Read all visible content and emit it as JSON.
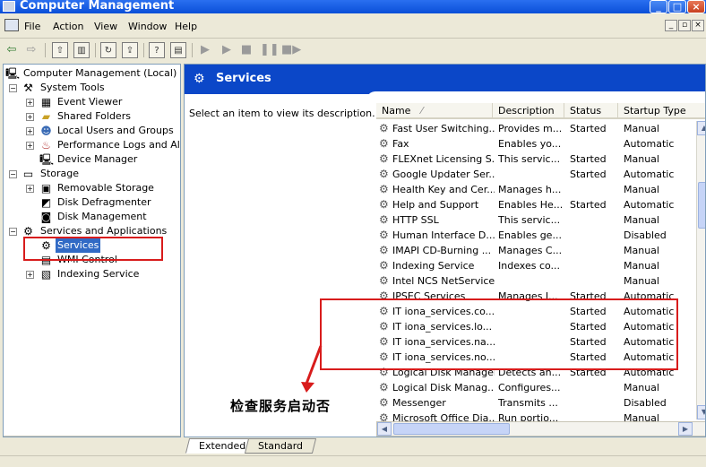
{
  "window": {
    "title": "Computer Management"
  },
  "menu": [
    "File",
    "Action",
    "View",
    "Window",
    "Help"
  ],
  "tree": [
    {
      "label": "Computer Management (Local)",
      "level": 0,
      "expander": "",
      "icon": "computer-icon"
    },
    {
      "label": "System Tools",
      "level": 1,
      "expander": "−",
      "icon": "tools-icon"
    },
    {
      "label": "Event Viewer",
      "level": 2,
      "expander": "+",
      "icon": "event-viewer-icon"
    },
    {
      "label": "Shared Folders",
      "level": 2,
      "expander": "+",
      "icon": "folder-icon"
    },
    {
      "label": "Local Users and Groups",
      "level": 2,
      "expander": "+",
      "icon": "users-icon"
    },
    {
      "label": "Performance Logs and Alerts",
      "level": 2,
      "expander": "+",
      "icon": "performance-icon"
    },
    {
      "label": "Device Manager",
      "level": 2,
      "expander": "",
      "icon": "device-manager-icon"
    },
    {
      "label": "Storage",
      "level": 1,
      "expander": "−",
      "icon": "storage-icon"
    },
    {
      "label": "Removable Storage",
      "level": 2,
      "expander": "+",
      "icon": "removable-storage-icon"
    },
    {
      "label": "Disk Defragmenter",
      "level": 2,
      "expander": "",
      "icon": "defrag-icon"
    },
    {
      "label": "Disk Management",
      "level": 2,
      "expander": "",
      "icon": "disk-icon"
    },
    {
      "label": "Services and Applications",
      "level": 1,
      "expander": "−",
      "icon": "services-apps-icon"
    },
    {
      "label": "Services",
      "level": 2,
      "expander": "",
      "icon": "gear-icon",
      "selected": true
    },
    {
      "label": "WMI Control",
      "level": 2,
      "expander": "",
      "icon": "wmi-icon"
    },
    {
      "label": "Indexing Service",
      "level": 2,
      "expander": "+",
      "icon": "indexing-icon"
    }
  ],
  "header": {
    "title": "Services"
  },
  "description": "Select an item to view its description.",
  "columns": [
    "Name",
    "Description",
    "Status",
    "Startup Type"
  ],
  "services": [
    [
      "Fast User Switching...",
      "Provides m...",
      "Started",
      "Manual"
    ],
    [
      "Fax",
      "Enables yo...",
      "",
      "Automatic"
    ],
    [
      "FLEXnet Licensing S...",
      "This servic...",
      "Started",
      "Manual"
    ],
    [
      "Google Updater Ser...",
      "",
      "Started",
      "Automatic"
    ],
    [
      "Health Key and Cer...",
      "Manages h...",
      "",
      "Manual"
    ],
    [
      "Help and Support",
      "Enables He...",
      "Started",
      "Automatic"
    ],
    [
      "HTTP SSL",
      "This servic...",
      "",
      "Manual"
    ],
    [
      "Human Interface D...",
      "Enables ge...",
      "",
      "Disabled"
    ],
    [
      "IMAPI CD-Burning ...",
      "Manages C...",
      "",
      "Manual"
    ],
    [
      "Indexing Service",
      "Indexes co...",
      "",
      "Manual"
    ],
    [
      "Intel NCS NetService",
      "",
      "",
      "Manual"
    ],
    [
      "IPSEC Services",
      "Manages I...",
      "Started",
      "Automatic"
    ],
    [
      "IT iona_services.co...",
      "",
      "Started",
      "Automatic"
    ],
    [
      "IT iona_services.lo...",
      "",
      "Started",
      "Automatic"
    ],
    [
      "IT iona_services.na...",
      "",
      "Started",
      "Automatic"
    ],
    [
      "IT iona_services.no...",
      "",
      "Started",
      "Automatic"
    ],
    [
      "Logical Disk Manager",
      "Detects an...",
      "Started",
      "Automatic"
    ],
    [
      "Logical Disk Manag...",
      "Configures...",
      "",
      "Manual"
    ],
    [
      "Messenger",
      "Transmits ...",
      "",
      "Disabled"
    ],
    [
      "Microsoft Office Dia...",
      "Run portio...",
      "",
      "Manual"
    ]
  ],
  "tabs": [
    "Extended",
    "Standard"
  ],
  "annotation": "检查服务启动否",
  "colors": {
    "title_bar": "#0a4fd8",
    "header": "#0b47c8",
    "selection": "#316ac5",
    "annotation_red": "#d81c1c"
  }
}
